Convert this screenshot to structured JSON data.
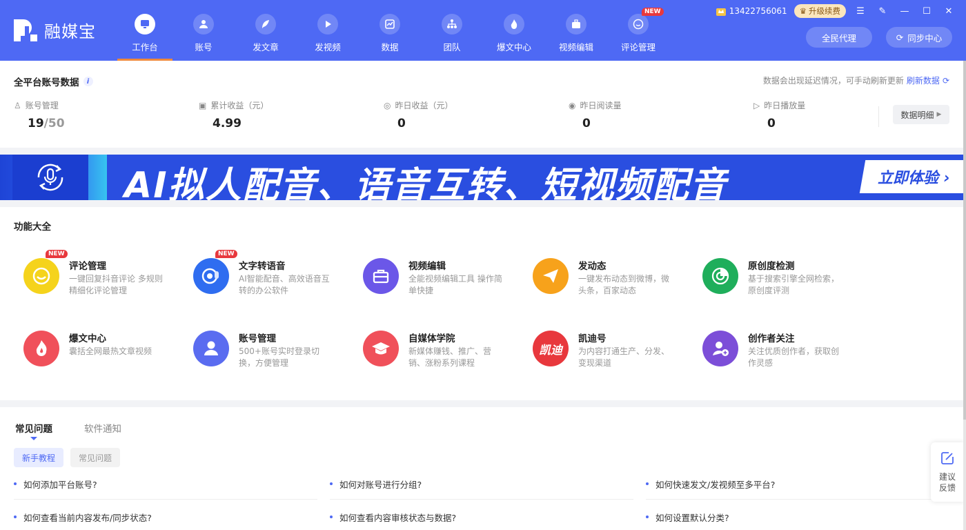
{
  "app": {
    "brand": "融媒宝",
    "phone": "13422756061",
    "upgrade_label": "升级续费",
    "agent_button": "全民代理",
    "sync_button": "同步中心"
  },
  "nav": [
    {
      "label": "工作台",
      "icon": "monitor-icon",
      "active": true
    },
    {
      "label": "账号",
      "icon": "user-icon"
    },
    {
      "label": "发文章",
      "icon": "feather-icon"
    },
    {
      "label": "发视频",
      "icon": "play-icon"
    },
    {
      "label": "数据",
      "icon": "chart-icon"
    },
    {
      "label": "团队",
      "icon": "org-icon"
    },
    {
      "label": "爆文中心",
      "icon": "flame-icon"
    },
    {
      "label": "视频编辑",
      "icon": "briefcase-icon"
    },
    {
      "label": "评论管理",
      "icon": "chat-icon",
      "badge": "NEW"
    }
  ],
  "stats": {
    "title": "全平台账号数据",
    "note": "数据会出现延迟情况，可手动刷新更新",
    "refresh_label": "刷新数据",
    "detail_label": "数据明细",
    "items": [
      {
        "label": "账号管理",
        "value": "19",
        "limit": "/50",
        "icon": "user-outline-icon"
      },
      {
        "label": "累计收益（元）",
        "value": "4.99",
        "icon": "wallet-icon"
      },
      {
        "label": "昨日收益（元）",
        "value": "0",
        "icon": "yen-icon"
      },
      {
        "label": "昨日阅读量",
        "value": "0",
        "icon": "eye-icon"
      },
      {
        "label": "昨日播放量",
        "value": "0",
        "icon": "play-circle-icon"
      }
    ]
  },
  "banner": {
    "headline": "AI拟人配音、语音互转、短视频配音",
    "cta": "立即体验"
  },
  "features": {
    "title": "功能大全",
    "items": [
      {
        "name": "评论管理",
        "desc": "一键回复抖音评论 多规则精细化评论管理",
        "badge": "NEW",
        "color": "#f5d31c"
      },
      {
        "name": "文字转语音",
        "desc": "AI智能配音、高效语音互转的办公软件",
        "badge": "NEW",
        "color": "#2f6df0"
      },
      {
        "name": "视频编辑",
        "desc": "全能视频编辑工具 操作简单快捷",
        "color": "#6b57e8"
      },
      {
        "name": "发动态",
        "desc": "一键发布动态到微博，微头条，百家动态",
        "color": "#f7a21b"
      },
      {
        "name": "原创度检测",
        "desc": "基于搜索引擎全网检索，原创度评测",
        "color": "#1fae5b"
      },
      {
        "name": "爆文中心",
        "desc": "囊括全网最热文章视频",
        "color": "#f0505a"
      },
      {
        "name": "账号管理",
        "desc": "500+账号实时登录切换，方便管理",
        "color": "#5a6cf0"
      },
      {
        "name": "自媒体学院",
        "desc": "新媒体赚钱、推广、营销、涨粉系列课程",
        "color": "#f0505a"
      },
      {
        "name": "凯迪号",
        "desc": "为内容打通生产、分发、变现渠道",
        "color": "#e8383d",
        "logo_text": "凯迪"
      },
      {
        "name": "创作者关注",
        "desc": "关注优质创作者，获取创作灵感",
        "color": "#7c4ed8"
      }
    ]
  },
  "faq": {
    "tabs": [
      "常见问题",
      "软件通知"
    ],
    "pills": [
      "新手教程",
      "常见问题"
    ],
    "questions": [
      "如何添加平台账号?",
      "如何对账号进行分组?",
      "如何快速发文/发视频至多平台?",
      "如何查看当前内容发布/同步状态?",
      "如何查看内容审核状态与数据?",
      "如何设置默认分类?"
    ]
  },
  "feedback": {
    "line1": "建议",
    "line2": "反馈"
  }
}
